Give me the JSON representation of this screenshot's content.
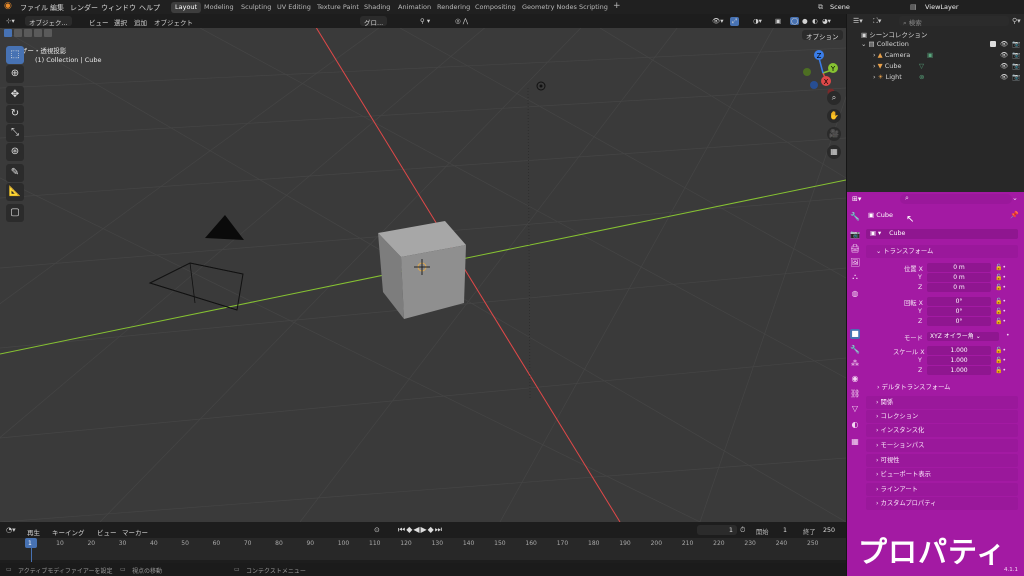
{
  "menu": {
    "items": [
      "ファイル",
      "編集",
      "レンダー",
      "ウィンドウ",
      "ヘルプ"
    ]
  },
  "workspaces": [
    "Layout",
    "Modeling",
    "Sculpting",
    "UV Editing",
    "Texture Paint",
    "Shading",
    "Animation",
    "Rendering",
    "Compositing",
    "Geometry Nodes",
    "Scripting"
  ],
  "workspace_add": "+",
  "scene": {
    "name": "Scene",
    "view_layer": "ViewLayer"
  },
  "viewport_header": {
    "mode": "オブジェク...",
    "view": "ビュー",
    "select": "選択",
    "add": "追加",
    "object": "オブジェクト",
    "orientation": "グロ...",
    "options": "オプション"
  },
  "viewport": {
    "view_name": "ユーザー・透視投影",
    "collection_info": "(1) Collection | Cube"
  },
  "gizmo": {
    "x": "X",
    "y": "Y",
    "z": "Z"
  },
  "outliner": {
    "search_placeholder": "検索",
    "root": "シーンコレクション",
    "collection": "Collection",
    "objects": [
      "Camera",
      "Cube",
      "Light"
    ]
  },
  "properties": {
    "search_placeholder": "",
    "object_name": "Cube",
    "data_name": "Cube",
    "transform_header": "トランスフォーム",
    "location_label": "位置 X",
    "rotation_label": "回転 X",
    "scale_label": "スケール X",
    "axis_y": "Y",
    "axis_z": "Z",
    "location": [
      "0 m",
      "0 m",
      "0 m"
    ],
    "rotation": [
      "0°",
      "0°",
      "0°"
    ],
    "mode_label": "モード",
    "mode_value": "XYZ オイラー角",
    "scale": [
      "1.000",
      "1.000",
      "1.000"
    ],
    "delta_transform": "デルタトランスフォーム",
    "panels": [
      "関係",
      "コレクション",
      "インスタンス化",
      "モーションパス",
      "可視性",
      "ビューポート表示",
      "ラインアート",
      "カスタムプロパティ"
    ]
  },
  "timeline": {
    "playback": "再生",
    "keying": "キーイング",
    "view": "ビュー",
    "marker": "マーカー",
    "current_frame": "1",
    "start_label": "開始",
    "start": "1",
    "end_label": "終了",
    "end": "250",
    "ticks": [
      "1",
      "10",
      "20",
      "30",
      "40",
      "50",
      "60",
      "70",
      "80",
      "90",
      "100",
      "110",
      "120",
      "130",
      "140",
      "150",
      "160",
      "170",
      "180",
      "190",
      "200",
      "210",
      "220",
      "230",
      "240",
      "250"
    ]
  },
  "statusbar": {
    "left": "アクティブモディファイアーを設定",
    "middle": "視点の移動",
    "right": "コンテクストメニュー",
    "version": "4.1.1"
  },
  "overlay_title": "プロパティ",
  "colors": {
    "properties_bg": "#a31aa3",
    "accent": "#4772b3",
    "x_axis": "#e04848",
    "y_axis": "#86c232",
    "z_axis": "#3a7de8"
  }
}
